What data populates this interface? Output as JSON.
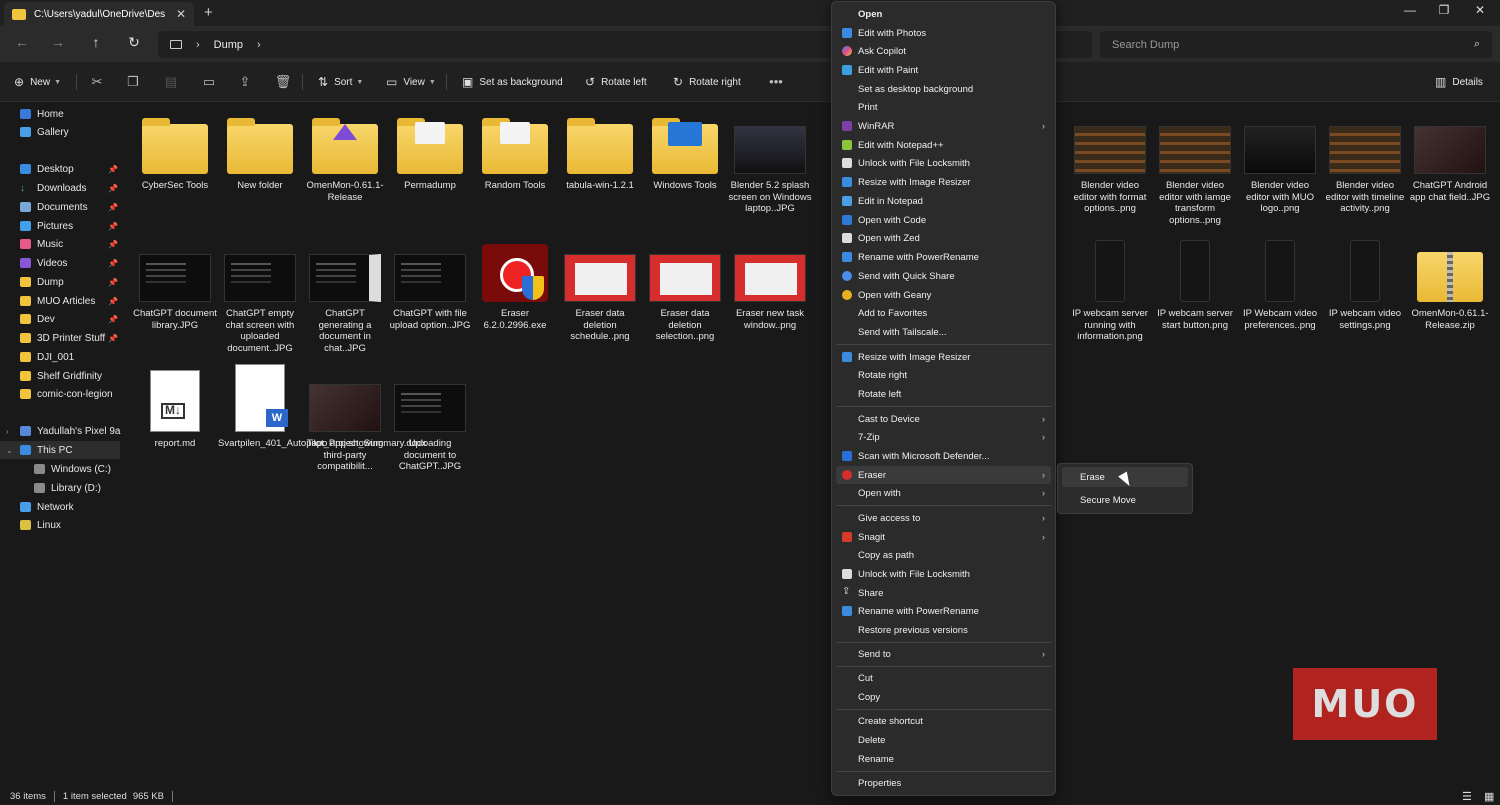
{
  "window": {
    "tab_title": "C:\\Users\\yadul\\OneDrive\\Des"
  },
  "address": {
    "crumb": "Dump",
    "search_placeholder": "Search Dump"
  },
  "cmdbar": {
    "new": "New",
    "sort": "Sort",
    "view": "View",
    "set_bg": "Set as background",
    "rotate_left": "Rotate left",
    "rotate_right": "Rotate right",
    "details": "Details"
  },
  "sidebar": {
    "home": "Home",
    "gallery": "Gallery",
    "desktop": "Desktop",
    "downloads": "Downloads",
    "documents": "Documents",
    "pictures": "Pictures",
    "music": "Music",
    "videos": "Videos",
    "dump": "Dump",
    "muo": "MUO Articles",
    "dev": "Dev",
    "printer": "3D Printer Stuff",
    "dji": "DJI_001",
    "shelf": "Shelf Gridfinity",
    "comic": "comic-con-legion",
    "phone": "Yadullah's Pixel 9a",
    "thispc": "This PC",
    "winc": "Windows (C:)",
    "libd": "Library (D:)",
    "network": "Network",
    "linux": "Linux"
  },
  "files": {
    "r1": [
      "CyberSec Tools",
      "New folder",
      "OmenMon-0.61.1-Release",
      "Permadump",
      "Random Tools",
      "tabula-win-1.2.1",
      "Windows Tools",
      "Blender 5.2 splash screen on Windows laptop..JPG"
    ],
    "r1b": [
      "Blender video editor with format options..png",
      "Blender video editor with iamge transform options..png",
      "Blender video editor with MUO logo..png",
      "Blender video editor with timeline activity..png",
      "ChatGPT Android app chat field..JPG"
    ],
    "r2": [
      "ChatGPT document library.JPG",
      "ChatGPT empty chat screen with uploaded document..JPG",
      "ChatGPT generating a document in chat..JPG",
      "ChatGPT with file upload option..JPG",
      "Eraser 6.2.0.2996.exe",
      "Eraser data deletion schedule..png",
      "Eraser data deletion selection..png",
      "Eraser new task window..png"
    ],
    "r2b": [
      "IP webcam server running with information.png",
      "IP webcam server start button.png",
      "IP Webcam video preferences..png",
      "IP webcam video settings.png",
      "OmenMon-0.61.1-Release.zip"
    ],
    "r3": [
      "report.md",
      "Svartpilen_401_Autopilot_Project_Summary.docx",
      "Tapo app showing third-party compatibilit...",
      "Uploading document to ChatGPT..JPG"
    ]
  },
  "status": {
    "count": "36 items",
    "selected": "1 item selected",
    "size": "965 KB"
  },
  "menu": {
    "items": [
      "Open",
      "Edit with Photos",
      "Ask Copilot",
      "Edit with Paint",
      "Set as desktop background",
      "Print",
      "WinRAR",
      "Edit with Notepad++",
      "Unlock with File Locksmith",
      "Resize with Image Resizer",
      "Edit in Notepad",
      "Open with Code",
      "Open with Zed",
      "Rename with PowerRename",
      "Send with Quick Share",
      "Open with Geany",
      "Add to Favorites",
      "Send with Tailscale...",
      "Resize with Image Resizer",
      "Rotate right",
      "Rotate left",
      "Cast to Device",
      "7-Zip",
      "Scan with Microsoft Defender...",
      "Eraser",
      "Open with",
      "Give access to",
      "Snagit",
      "Copy as path",
      "Unlock with File Locksmith",
      "Share",
      "Rename with PowerRename",
      "Restore previous versions",
      "Send to",
      "Cut",
      "Copy",
      "Create shortcut",
      "Delete",
      "Rename",
      "Properties"
    ],
    "sub": [
      "Erase",
      "Secure Move"
    ]
  },
  "logo_text": "MUO",
  "colors": {
    "accent": "#f0c43c",
    "logo": "#b0231e",
    "menu_bg": "#2b2b2b"
  }
}
